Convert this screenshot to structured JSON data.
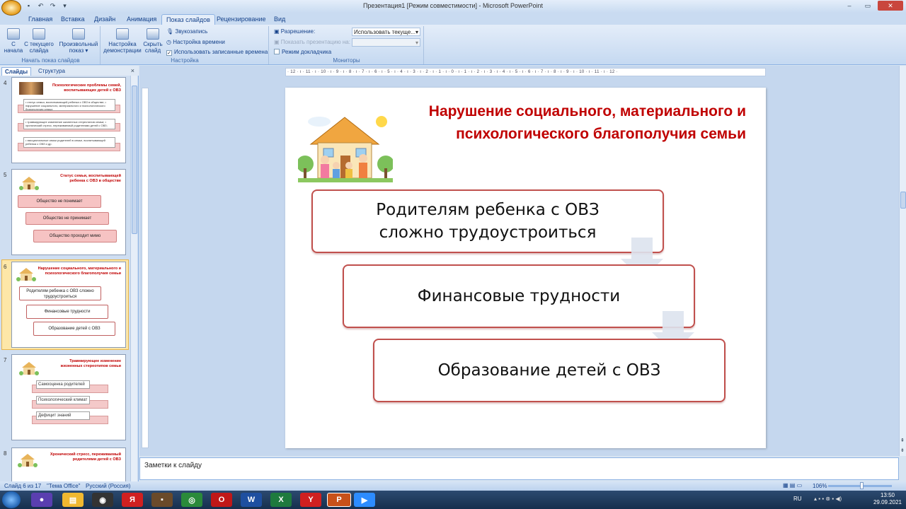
{
  "window": {
    "title": "Презентация1 [Режим совместимости] - Microsoft PowerPoint"
  },
  "ribbon_tabs": [
    "Главная",
    "Вставка",
    "Дизайн",
    "Анимация",
    "Показ слайдов",
    "Рецензирование",
    "Вид"
  ],
  "active_tab": "Показ слайдов",
  "ribbon": {
    "start_group": {
      "title": "Начать показ слайдов",
      "from_start": "С\nначала",
      "from_current": "С текущего\nслайда",
      "custom_show": "Произвольный\nпоказ ▾"
    },
    "setup_group": {
      "title": "Настройка",
      "setup_show": "Настройка\nдемонстрации",
      "hide_slide": "Скрыть\nслайд",
      "record_narration": "Звукозапись",
      "rehearse_timings": "Настройка времени",
      "use_timings": "Использовать записанные времена",
      "use_timings_checked": true
    },
    "monitors_group": {
      "title": "Мониторы",
      "resolution_label": "Разрешение:",
      "resolution_value": "Использовать текуще...",
      "show_on_label": "Показать презентацию на:",
      "presenter_view": "Режим докладчика",
      "presenter_view_checked": false
    }
  },
  "left_pane": {
    "tabs": [
      "Слайды",
      "Структура"
    ],
    "active_tab": "Слайды",
    "close": "×",
    "thumbnails": [
      {
        "number": "4",
        "title": "Психологические проблемы семей, воспитывающих детей с ОВЗ",
        "lines": [
          "• статус семьи, воспитывающей ребенка с ОВЗ в обществе; • нарушение социального, материального и психологического благополучия семьи;",
          "• травмирующее изменение жизненных стереотипов семьи; • хронический стресс, переживаемый родителями детей с ОВЗ;",
          "• эмоциональные связи родителей в семье, воспитывающей ребенка с ОВЗ и др."
        ]
      },
      {
        "number": "5",
        "title": "Статус семьи, воспитывающей ребенка с ОВЗ в обществе",
        "items": [
          "Общество не понимает",
          "Общество не принимает",
          "Общество проходит мимо"
        ]
      },
      {
        "number": "6",
        "title": "Нарушение социального, материального и психологического благополучия семьи",
        "items": [
          "Родителям ребенка с ОВЗ сложно трудоустроиться",
          "Финансовые трудности",
          "Образование детей с ОВЗ"
        ],
        "selected": true
      },
      {
        "number": "7",
        "title": "Травмирующее изменение жизненных стереотипов семьи",
        "items": [
          "Самооценка родителей",
          "Психологический климат",
          "Дефицит знаний"
        ]
      },
      {
        "number": "8",
        "title": "Хронический стресс, переживаемый родителями детей с ОВЗ"
      }
    ]
  },
  "slide": {
    "title_line1": "Нарушение социального, материального и",
    "title_line2": "психологического благополучия семьи",
    "box1_line1": "Родителям ребенка с ОВЗ",
    "box1_line2": "сложно трудоустроиться",
    "box2": "Финансовые трудности",
    "box3": "Образование детей с ОВЗ"
  },
  "ruler_text": "· 12 · ı · 11 · ı · 10 · ı · 9 · ı · 8 · ı · 7 · ı · 6 · ı · 5 · ı · 4 · ı · 3 · ı · 2 · ı · 1 · ı · 0 · ı · 1 · ı · 2 · ı · 3 · ı · 4 · ı · 5 · ı · 6 · ı · 7 · ı · 8 · ı · 9 · ı · 10 · ı · 11 · ı · 12 ·",
  "notes": {
    "placeholder": "Заметки к слайду"
  },
  "status": {
    "slide_of": "Слайд 6 из 17",
    "theme": "\"Тема Office\"",
    "language": "Русский (Россия)",
    "zoom": "106%"
  },
  "taskbar": {
    "lang": "RU",
    "time": "13:50",
    "date": "29.09.2021"
  },
  "colors": {
    "title_red": "#c00000",
    "box_border": "#c0504d",
    "ribbon_blue": "#15428b"
  }
}
